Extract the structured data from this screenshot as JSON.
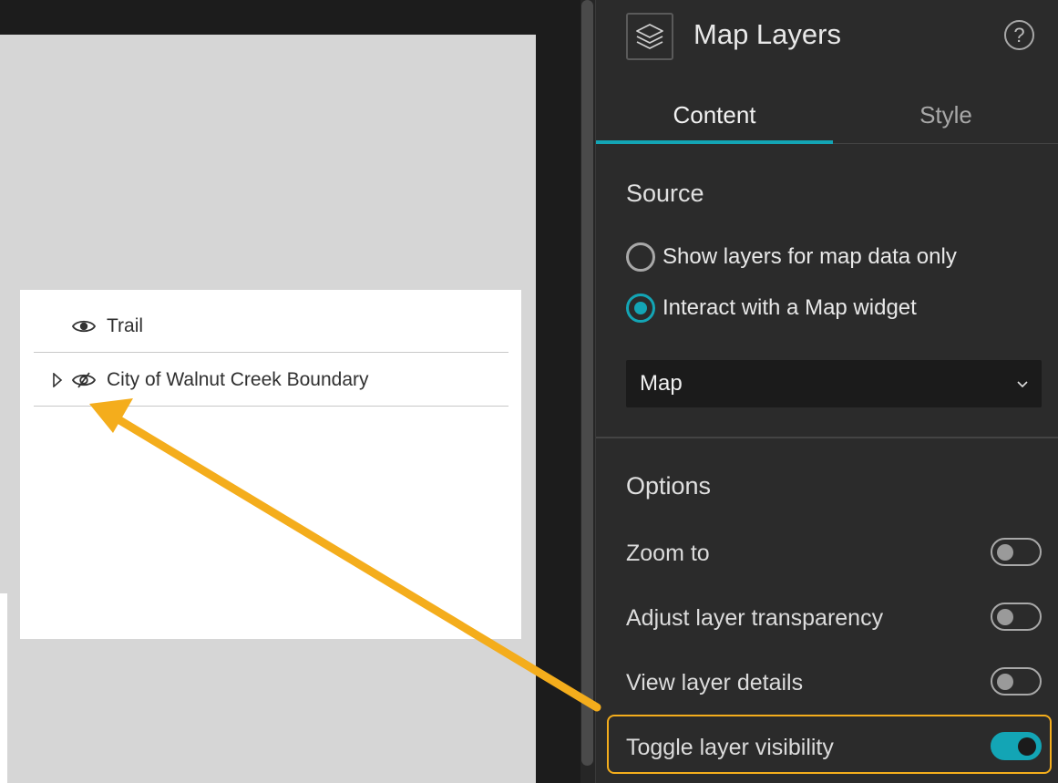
{
  "layer_list": {
    "items": [
      {
        "label": "Trail",
        "has_expand": false,
        "visible": true
      },
      {
        "label": "City of Walnut Creek Boundary",
        "has_expand": true,
        "visible": false
      }
    ]
  },
  "panel": {
    "title": "Map Layers",
    "help_symbol": "?",
    "icon": "layers-icon",
    "tabs": [
      {
        "label": "Content",
        "active": true
      },
      {
        "label": "Style",
        "active": false
      }
    ],
    "source": {
      "title": "Source",
      "options": [
        {
          "label": "Show layers for map data only",
          "checked": false
        },
        {
          "label": "Interact with a Map widget",
          "checked": true
        }
      ],
      "map_select": {
        "value": "Map"
      }
    },
    "options": {
      "title": "Options",
      "items": [
        {
          "label": "Zoom to",
          "on": false
        },
        {
          "label": "Adjust layer transparency",
          "on": false
        },
        {
          "label": "View layer details",
          "on": false
        },
        {
          "label": "Toggle layer visibility",
          "on": true,
          "highlighted": true
        }
      ]
    }
  },
  "colors": {
    "accent": "#13a5b5",
    "annotation": "#f4ad1c",
    "panel_bg": "#2b2b2b",
    "canvas_bg": "#d6d6d6"
  }
}
